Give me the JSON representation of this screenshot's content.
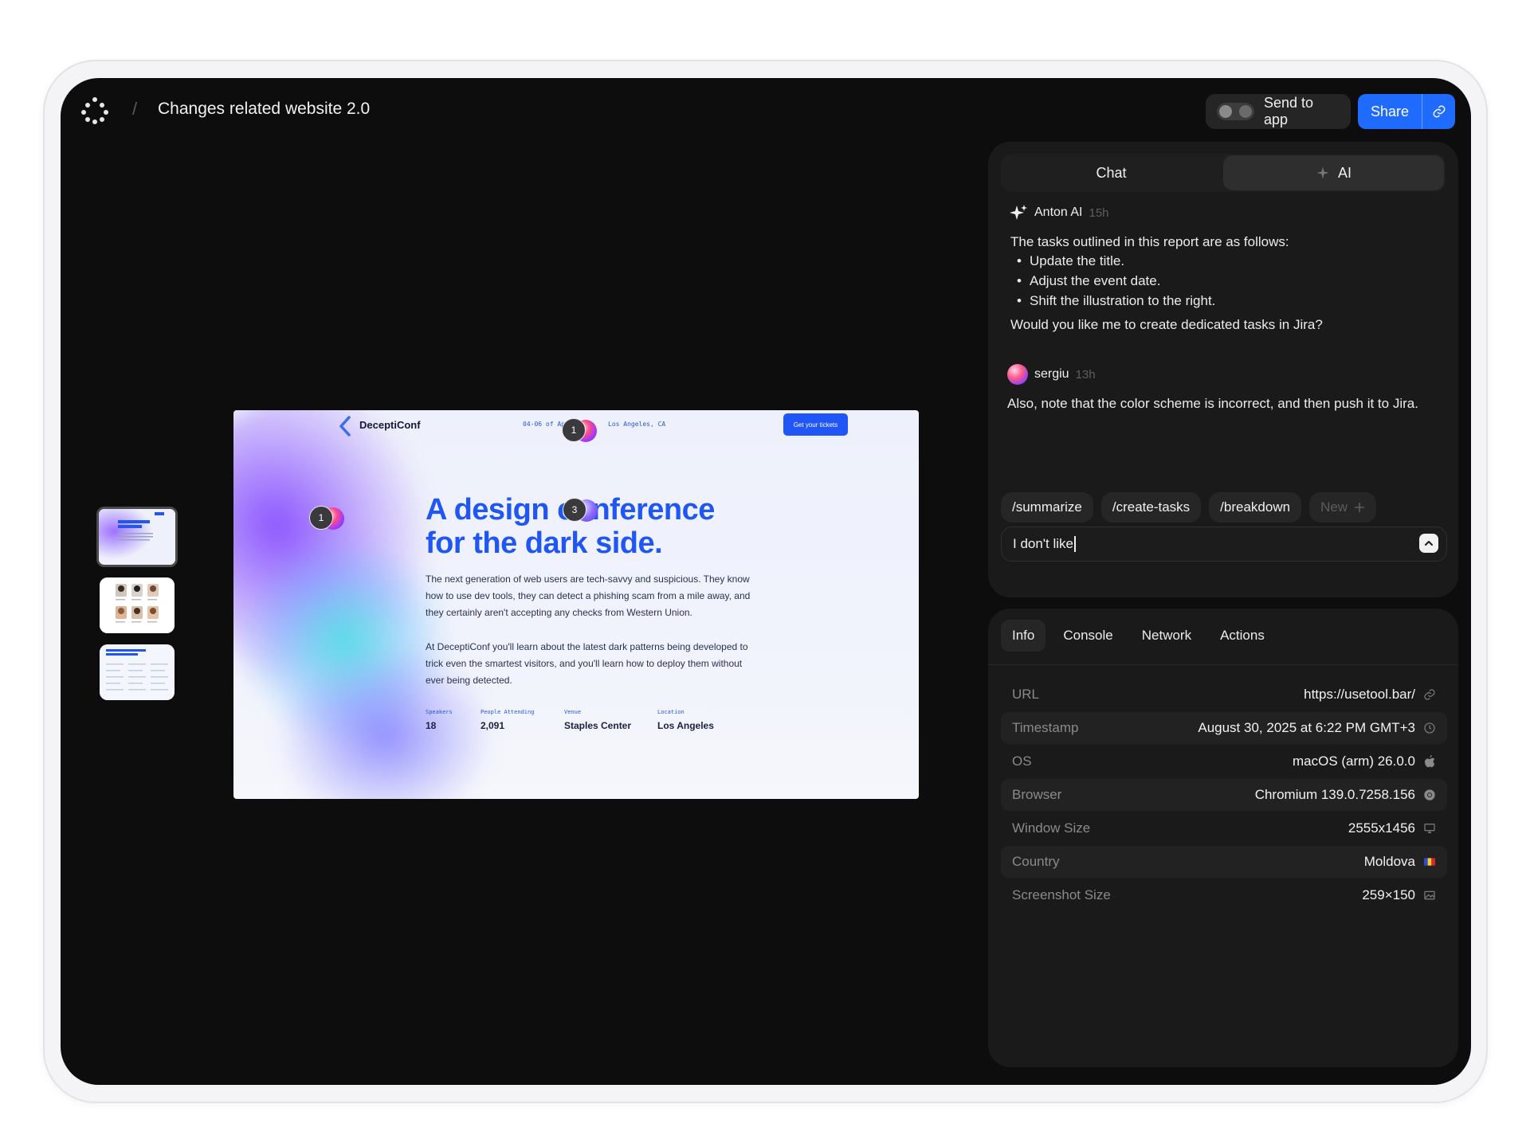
{
  "header": {
    "breadcrumb_separator": "/",
    "title": "Changes related website 2.0",
    "send_to_app_label": "Send to app",
    "share_label": "Share"
  },
  "colors": {
    "accent": "#1f6bff",
    "background": "#0d0d0d",
    "panel": "#1a1a1a"
  },
  "preview": {
    "brand": "DeceptiConf",
    "date": "04-06 of Ap",
    "location": "Los Angeles, CA",
    "cta": "Get your tickets",
    "headline": "A design conference for the dark side.",
    "paragraph_1": "The next generation of web users are tech-savvy and suspicious. They know how to use dev tools, they can detect a phishing scam from a mile away, and they certainly aren't accepting any checks from Western Union.",
    "paragraph_2": "At DeceptiConf you'll learn about the latest dark patterns being developed to trick even the smartest visitors, and you'll learn how to deploy them without ever being detected.",
    "stats": [
      {
        "label": "Speakers",
        "value": "18"
      },
      {
        "label": "People Attending",
        "value": "2,091"
      },
      {
        "label": "Venue",
        "value": "Staples Center"
      },
      {
        "label": "Location",
        "value": "Los Angeles"
      }
    ],
    "markers": [
      "1",
      "1",
      "3"
    ]
  },
  "chat": {
    "tabs": [
      "Chat",
      "AI"
    ],
    "active_tab": "AI",
    "messages": [
      {
        "author": "Anton AI",
        "time": "15h",
        "intro": "The tasks outlined in this report are as follows:",
        "bullets": [
          "Update the title.",
          "Adjust the event date.",
          "Shift the illustration to the right."
        ],
        "outro": "Would you like me to create dedicated tasks in Jira?"
      },
      {
        "author": "sergiu",
        "time": "13h",
        "text": "Also, note that the color scheme is incorrect, and then push it to Jira."
      }
    ],
    "commands": [
      "/summarize",
      "/create-tasks",
      "/breakdown"
    ],
    "new_command_label": "New",
    "input_value": "I don't like"
  },
  "info": {
    "tabs": [
      "Info",
      "Console",
      "Network",
      "Actions"
    ],
    "active_tab": "Info",
    "rows": [
      {
        "key": "URL",
        "value": "https://usetool.bar/",
        "icon": "link-icon"
      },
      {
        "key": "Timestamp",
        "value": "August 30, 2025 at 6:22 PM GMT+3",
        "icon": "clock-icon"
      },
      {
        "key": "OS",
        "value": "macOS (arm) 26.0.0",
        "icon": "apple-icon"
      },
      {
        "key": "Browser",
        "value": "Chromium 139.0.7258.156",
        "icon": "chrome-icon"
      },
      {
        "key": "Window Size",
        "value": "2555x1456",
        "icon": "monitor-icon"
      },
      {
        "key": "Country",
        "value": "Moldova",
        "icon": "flag-icon"
      },
      {
        "key": "Screenshot Size",
        "value": "259×150",
        "icon": "image-icon"
      }
    ]
  }
}
